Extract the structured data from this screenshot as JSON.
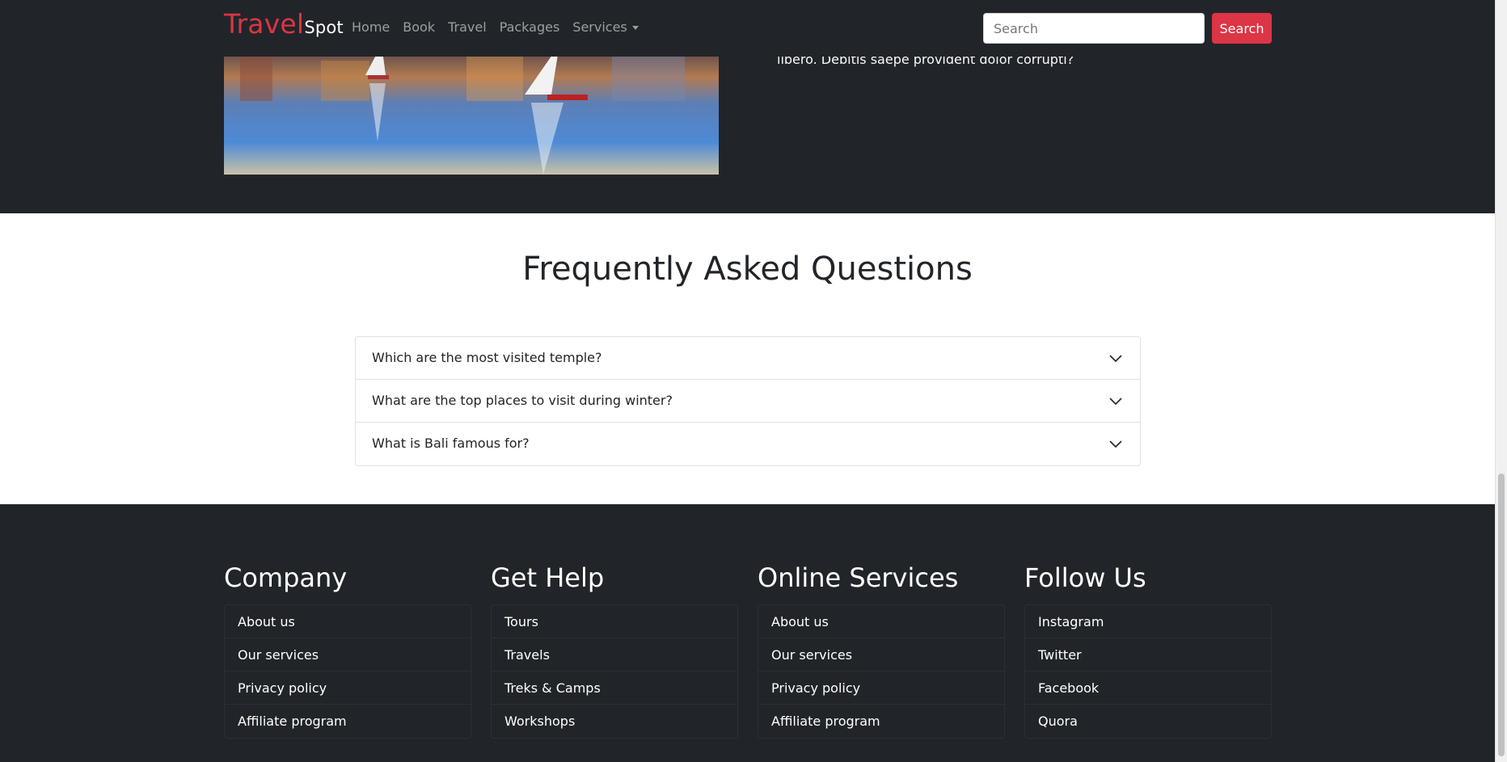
{
  "navbar": {
    "brand_main": "Travel",
    "brand_sub": "Spot",
    "links": [
      "Home",
      "Book",
      "Travel",
      "Packages",
      "Services"
    ],
    "search_placeholder": "Search",
    "search_button": "Search"
  },
  "hero": {
    "text_partial": "libero. Debitis saepe provident dolor corrupti?"
  },
  "faq": {
    "title": "Frequently Asked Questions",
    "items": [
      "Which are the most visited temple?",
      "What are the top places to visit during winter?",
      "What is Bali famous for?"
    ]
  },
  "footer": {
    "columns": [
      {
        "title": "Company",
        "links": [
          "About us",
          "Our services",
          "Privacy policy",
          "Affiliate program"
        ]
      },
      {
        "title": "Get Help",
        "links": [
          "Tours",
          "Travels",
          "Treks & Camps",
          "Workshops"
        ]
      },
      {
        "title": "Online Services",
        "links": [
          "About us",
          "Our services",
          "Privacy policy",
          "Affiliate program"
        ]
      },
      {
        "title": "Follow Us",
        "links": [
          "Instagram",
          "Twitter",
          "Facebook",
          "Quora"
        ]
      }
    ]
  },
  "colors": {
    "dark_bg": "#212529",
    "accent": "#dc3545",
    "white": "#ffffff"
  }
}
